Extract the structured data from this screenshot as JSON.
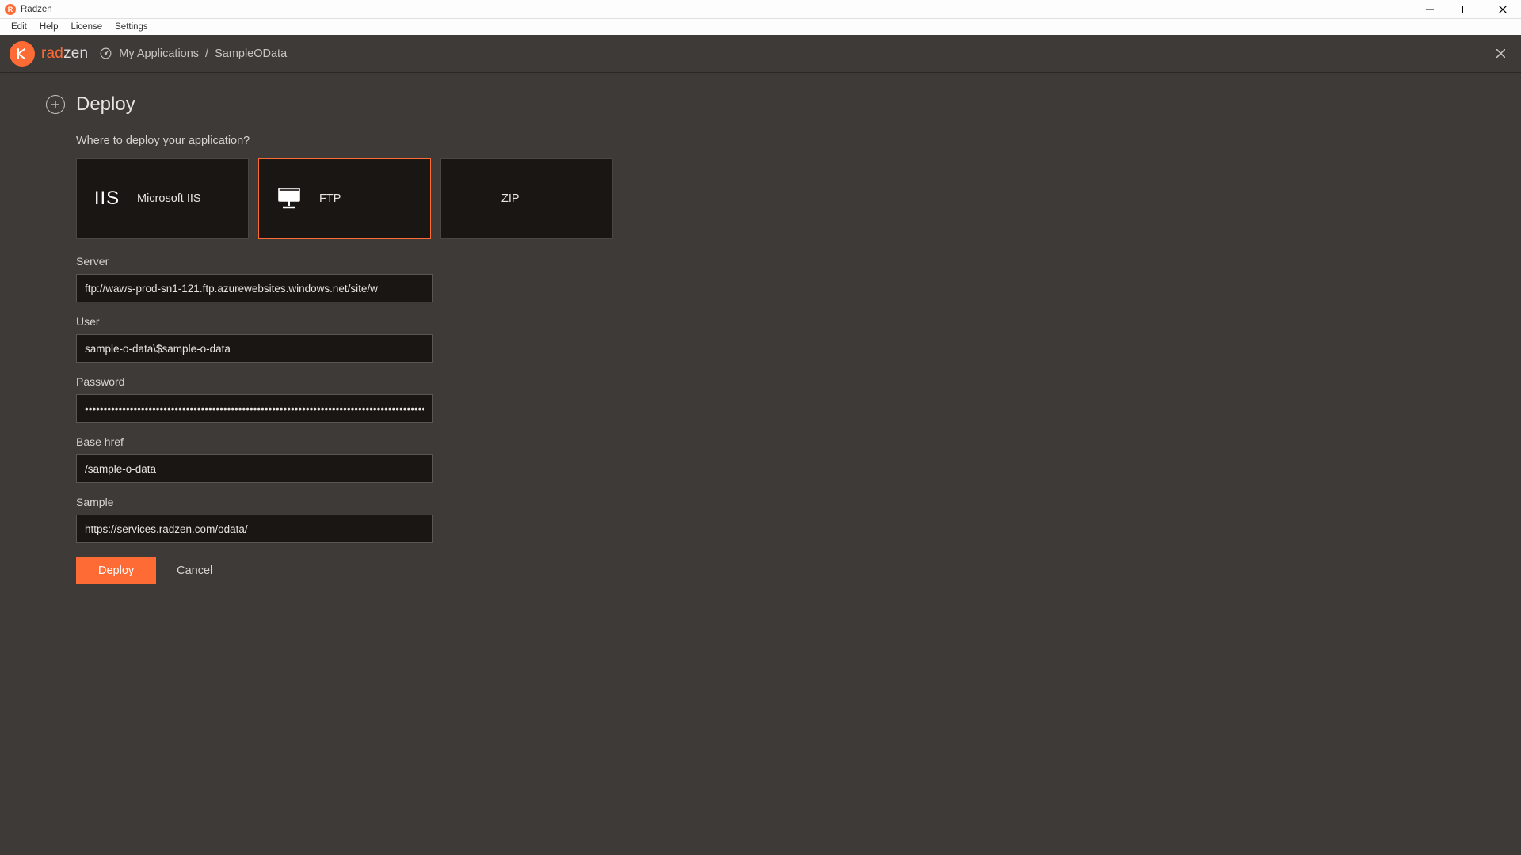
{
  "window": {
    "title": "Radzen"
  },
  "menubar": {
    "items": [
      "Edit",
      "Help",
      "License",
      "Settings"
    ]
  },
  "header": {
    "brand_rad": "rad",
    "brand_zen": "zen",
    "breadcrumb_root": "My Applications",
    "breadcrumb_sep": "/",
    "breadcrumb_current": "SampleOData"
  },
  "page": {
    "title": "Deploy",
    "question": "Where to deploy your application?"
  },
  "deploy_options": [
    {
      "id": "iis",
      "label": "Microsoft IIS",
      "selected": false
    },
    {
      "id": "ftp",
      "label": "FTP",
      "selected": true
    },
    {
      "id": "zip",
      "label": "ZIP",
      "selected": false
    }
  ],
  "form": {
    "server_label": "Server",
    "server_value": "ftp://waws-prod-sn1-121.ftp.azurewebsites.windows.net/site/w",
    "user_label": "User",
    "user_value": "sample-o-data\\$sample-o-data",
    "password_label": "Password",
    "password_value": "••••••••••••••••••••••••••••••••••••••••••••••••••••••••••••••••••••••••••••••••••••••••••••",
    "basehref_label": "Base href",
    "basehref_value": "/sample-o-data",
    "sample_label": "Sample",
    "sample_value": "https://services.radzen.com/odata/"
  },
  "actions": {
    "deploy": "Deploy",
    "cancel": "Cancel"
  }
}
